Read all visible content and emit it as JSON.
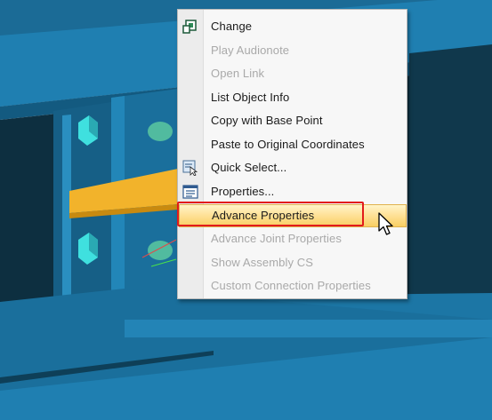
{
  "context_menu": {
    "items": [
      {
        "label": "Change",
        "state": "enabled",
        "icon": "change-icon"
      },
      {
        "label": "Play Audionote",
        "state": "disabled",
        "icon": null
      },
      {
        "label": "Open Link",
        "state": "disabled",
        "icon": null
      },
      {
        "label": "List Object Info",
        "state": "enabled",
        "icon": null
      },
      {
        "label": "Copy with Base Point",
        "state": "enabled",
        "icon": null
      },
      {
        "label": "Paste to Original Coordinates",
        "state": "enabled",
        "icon": null
      },
      {
        "label": "Quick Select...",
        "state": "enabled",
        "icon": "quick-select-icon"
      },
      {
        "label": "Properties...",
        "state": "enabled",
        "icon": "properties-icon"
      },
      {
        "label": "Advance Properties",
        "state": "highlighted",
        "icon": null
      },
      {
        "label": "Advance Joint Properties",
        "state": "disabled",
        "icon": null
      },
      {
        "label": "Show Assembly CS",
        "state": "disabled",
        "icon": null
      },
      {
        "label": "Custom Connection Properties",
        "state": "disabled",
        "icon": null
      }
    ]
  },
  "annotation": {
    "callout_color": "#e21b1b",
    "target": "Advance Properties"
  },
  "colors": {
    "steel_blue": "#1f77a6",
    "steel_dark": "#0c2c3c",
    "plate_yellow": "#f2b32b",
    "bolt_cyan": "#3fe0df",
    "highlight_gold": "#ffe29a"
  }
}
